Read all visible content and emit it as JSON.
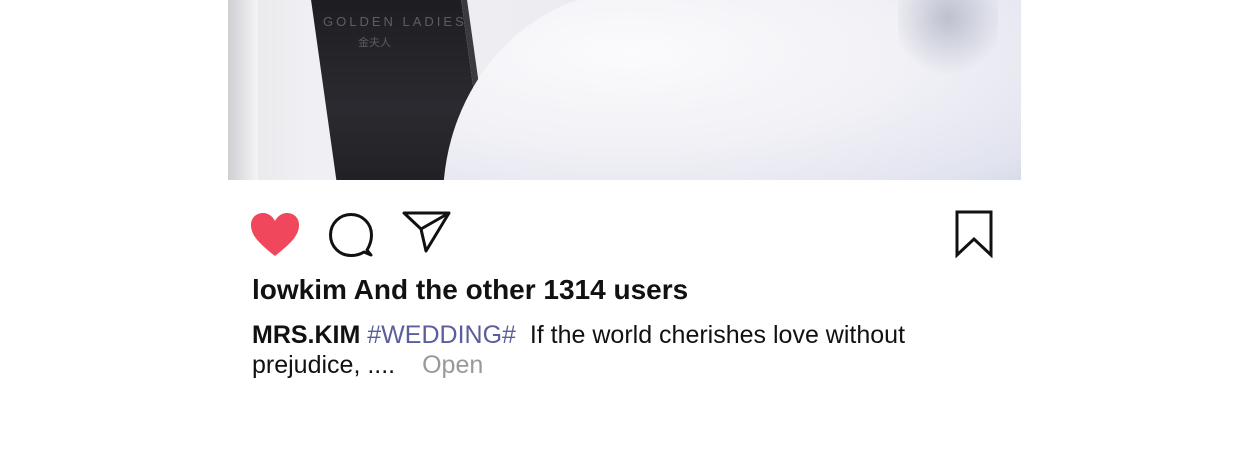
{
  "photo": {
    "watermark": "GOLDEN LADIES",
    "watermark_sub": "金夫人"
  },
  "actions": {
    "like_icon": "heart-filled-icon",
    "comment_icon": "comment-bubble-icon",
    "share_icon": "send-icon",
    "save_icon": "bookmark-icon",
    "like_color": "#f1475d"
  },
  "likes": {
    "text": "lowkim And the other 1314 users"
  },
  "caption": {
    "username": "MRS.KIM",
    "hashtag": "#WEDDING#",
    "text": "If the world cherishes love without prejudice, ....",
    "more_label": "Open"
  }
}
